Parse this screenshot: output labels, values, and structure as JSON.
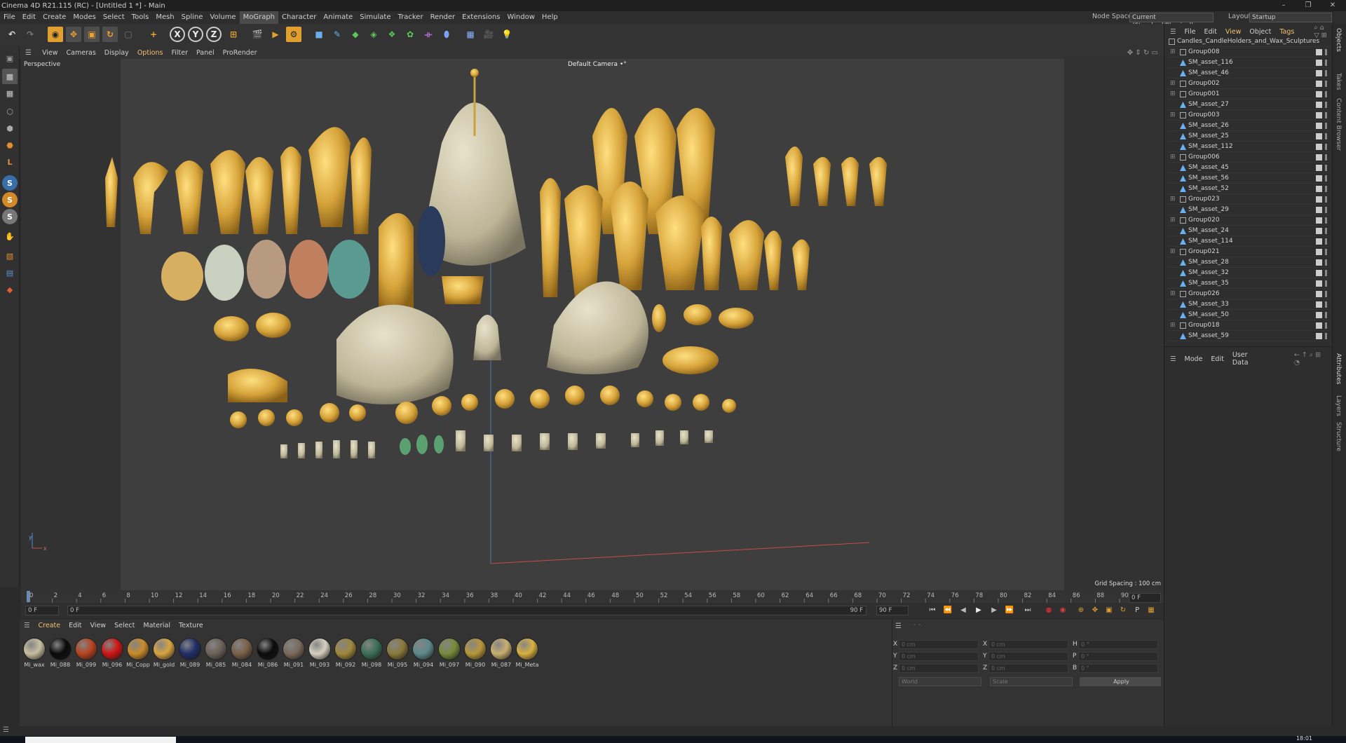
{
  "window": {
    "title": "Cinema 4D R21.115 (RC) - [Untitled 1 *] - Main",
    "controls": [
      "–",
      "❐",
      "✕"
    ]
  },
  "menu": {
    "items": [
      "File",
      "Edit",
      "Create",
      "Modes",
      "Select",
      "Tools",
      "Mesh",
      "Spline",
      "Volume",
      "MoGraph",
      "Character",
      "Animate",
      "Simulate",
      "Tracker",
      "Render",
      "Extensions",
      "Window",
      "Help"
    ],
    "active": "MoGraph",
    "node_space_label": "Node Space:",
    "node_space_value": "Current (Standard/Physical)",
    "layout_label": "Layout:",
    "layout_value": "Startup"
  },
  "toolbar": {
    "axis_x": "X",
    "axis_y": "Y",
    "axis_z": "Z"
  },
  "viewport": {
    "menu": [
      "View",
      "Cameras",
      "Display",
      "Options",
      "Filter",
      "Panel",
      "ProRender"
    ],
    "active_menu": "Options",
    "view_name": "Perspective",
    "camera_name": "Default Camera",
    "camera_suffix": "•°",
    "grid_spacing": "Grid Spacing : 100 cm",
    "axis_y_label": "y",
    "axis_x_label": "x"
  },
  "timeline": {
    "ticks": [
      "0",
      "2",
      "4",
      "6",
      "8",
      "10",
      "12",
      "14",
      "16",
      "18",
      "20",
      "22",
      "24",
      "26",
      "28",
      "30",
      "32",
      "34",
      "36",
      "38",
      "40",
      "42",
      "44",
      "46",
      "48",
      "50",
      "52",
      "54",
      "56",
      "58",
      "60",
      "62",
      "64",
      "66",
      "68",
      "70",
      "72",
      "74",
      "76",
      "78",
      "80",
      "82",
      "84",
      "86",
      "88",
      "90"
    ],
    "current_frame": "0 F",
    "end_field": "0 F",
    "start_field": "0 F",
    "min_field": "0 F",
    "max_field": "90 F",
    "end_frame": "90 F"
  },
  "materials": {
    "menu": [
      "Create",
      "Edit",
      "View",
      "Select",
      "Material",
      "Texture"
    ],
    "items": [
      {
        "name": "Mi_wax",
        "color": "#c9bf9f"
      },
      {
        "name": "Mi_088",
        "color": "#0a0a0a"
      },
      {
        "name": "Mi_099",
        "color": "#b8431e"
      },
      {
        "name": "Mi_096",
        "color": "#d11414"
      },
      {
        "name": "Mi_Copp",
        "color": "#c98b2a"
      },
      {
        "name": "Mi_gold",
        "color": "#d9a441"
      },
      {
        "name": "Mi_089",
        "color": "#1f2f6a"
      },
      {
        "name": "Mi_085",
        "color": "#6b6258"
      },
      {
        "name": "Mi_084",
        "color": "#7a6048"
      },
      {
        "name": "Mi_086",
        "color": "#0c0c0c"
      },
      {
        "name": "Mi_091",
        "color": "#7a6a5a"
      },
      {
        "name": "Mi_093",
        "color": "#d6d0c0"
      },
      {
        "name": "Mi_092",
        "color": "#a0883a"
      },
      {
        "name": "Mi_098",
        "color": "#3a6e5a"
      },
      {
        "name": "Mi_095",
        "color": "#8a7a3a"
      },
      {
        "name": "Mi_094",
        "color": "#5e8a8a"
      },
      {
        "name": "Mi_097",
        "color": "#7a8a3a"
      },
      {
        "name": "Mi_090",
        "color": "#b8963a"
      },
      {
        "name": "Mi_087",
        "color": "#c8b070"
      },
      {
        "name": "Mi_Meta",
        "color": "#d8b040"
      }
    ]
  },
  "coordinates": {
    "rows": [
      {
        "a": "X",
        "av": "0 cm",
        "b": "X",
        "bv": "0 cm",
        "c": "H",
        "cv": "0 °"
      },
      {
        "a": "Y",
        "av": "0 cm",
        "b": "Y",
        "bv": "0 cm",
        "c": "P",
        "cv": "0 °"
      },
      {
        "a": "Z",
        "av": "0 cm",
        "b": "Z",
        "bv": "0 cm",
        "c": "B",
        "cv": "0 °"
      }
    ],
    "space": "World",
    "mode": "Scale",
    "apply": "Apply"
  },
  "objects": {
    "menu": [
      "File",
      "Edit",
      "View",
      "Object",
      "Tags"
    ],
    "root": "Candles_CandleHolders_and_Wax_Sculptures",
    "rows": [
      {
        "label": "Group008",
        "kind": "group"
      },
      {
        "label": "SM_asset_116",
        "kind": "asset"
      },
      {
        "label": "SM_asset_46",
        "kind": "asset"
      },
      {
        "label": "Group002",
        "kind": "group"
      },
      {
        "label": "Group001",
        "kind": "group"
      },
      {
        "label": "SM_asset_27",
        "kind": "asset"
      },
      {
        "label": "Group003",
        "kind": "group"
      },
      {
        "label": "SM_asset_26",
        "kind": "asset"
      },
      {
        "label": "SM_asset_25",
        "kind": "asset"
      },
      {
        "label": "SM_asset_112",
        "kind": "asset"
      },
      {
        "label": "Group006",
        "kind": "group"
      },
      {
        "label": "SM_asset_45",
        "kind": "asset"
      },
      {
        "label": "SM_asset_56",
        "kind": "asset"
      },
      {
        "label": "SM_asset_52",
        "kind": "asset"
      },
      {
        "label": "Group023",
        "kind": "group"
      },
      {
        "label": "SM_asset_29",
        "kind": "asset"
      },
      {
        "label": "Group020",
        "kind": "group"
      },
      {
        "label": "SM_asset_24",
        "kind": "asset"
      },
      {
        "label": "SM_asset_114",
        "kind": "asset"
      },
      {
        "label": "Group021",
        "kind": "group"
      },
      {
        "label": "SM_asset_28",
        "kind": "asset"
      },
      {
        "label": "SM_asset_32",
        "kind": "asset"
      },
      {
        "label": "SM_asset_35",
        "kind": "asset"
      },
      {
        "label": "Group026",
        "kind": "group"
      },
      {
        "label": "SM_asset_33",
        "kind": "asset"
      },
      {
        "label": "SM_asset_50",
        "kind": "asset"
      },
      {
        "label": "Group018",
        "kind": "group"
      },
      {
        "label": "SM_asset_59",
        "kind": "asset"
      }
    ]
  },
  "attributes": {
    "menu": [
      "Mode",
      "Edit",
      "User Data"
    ]
  },
  "side_tabs": [
    "Objects",
    "Takes",
    "Content Browser",
    "Attributes",
    "Layers",
    "Structure"
  ],
  "taskbar": {
    "time": "18:01"
  }
}
